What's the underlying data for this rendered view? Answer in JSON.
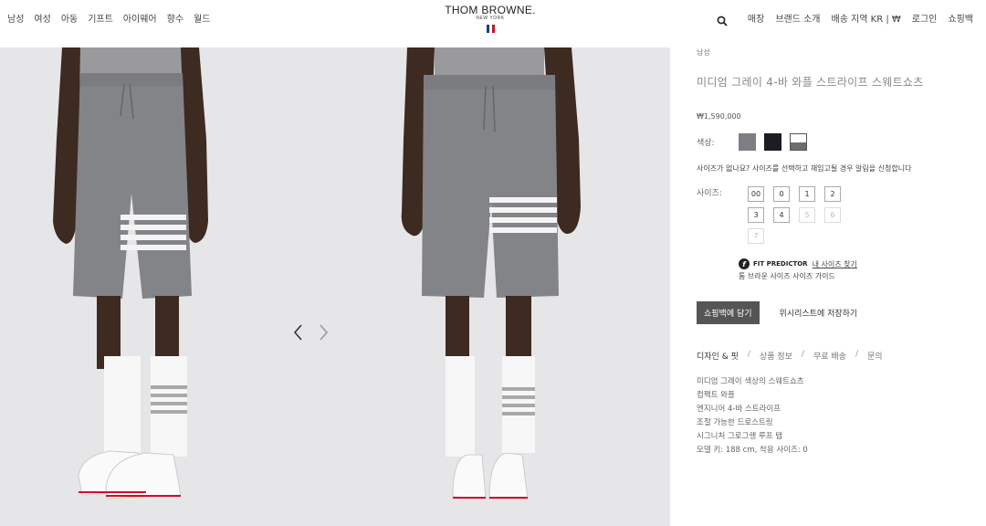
{
  "header": {
    "nav_left": [
      "남성",
      "여성",
      "아동",
      "기프트",
      "아이웨어",
      "향수",
      "월드"
    ],
    "logo_main": "THOM BROWNE.",
    "logo_sub": "NEW YORK",
    "nav_right": [
      "매장",
      "브랜드 소개",
      "배송 지역 KR | ₩",
      "로그인",
      "쇼핑백"
    ],
    "flag_colors": [
      "#1d3a8a",
      "#ffffff",
      "#c8102e"
    ]
  },
  "product": {
    "category": "남성",
    "title": "미디엄 그레이 4-바 와플 스트라이프 스웨트쇼츠",
    "price": "₩1,590,000",
    "color_label": "색상:",
    "colors": [
      {
        "name": "medium-gray",
        "hex": "#7d7f84"
      },
      {
        "name": "black",
        "hex": "#1c1d22"
      },
      {
        "name": "white-gray",
        "hex": "#ffffff"
      }
    ],
    "size_note": "사이즈가 없나요? 사이즈를 선택하고 재입고될 경우 알림을 신청합니다",
    "size_label": "사이즈:",
    "sizes": [
      {
        "label": "00",
        "available": true
      },
      {
        "label": "0",
        "available": true
      },
      {
        "label": "1",
        "available": true
      },
      {
        "label": "2",
        "available": true
      },
      {
        "label": "3",
        "available": true
      },
      {
        "label": "4",
        "available": true
      },
      {
        "label": "5",
        "available": false
      },
      {
        "label": "6",
        "available": false
      },
      {
        "label": "7",
        "available": false
      }
    ],
    "fit_predictor_label": "FIT PREDICTOR",
    "fit_link": "내 사이즈 찾기",
    "size_guide": "톰 브라운 사이즈 사이즈 가이드",
    "add_to_bag": "쇼핑백에 담기",
    "save_wishlist": "위시리스트에 저장하기",
    "tabs": [
      "디자인 & 핏",
      "상품 정보",
      "무료 배송",
      "문의"
    ],
    "description": [
      "미디엄 그레이 색상의 스웨트쇼츠",
      "컴팩트 와플",
      "엔지니어 4-바 스트라이프",
      "조절 가능한 드로스트링",
      "시그니처 그로그랭 루프 탭",
      "모델 키: 188 cm, 착용 사이즈: 0"
    ]
  },
  "gallery": {
    "prev_icon": "chevron-left-icon",
    "next_icon": "chevron-right-icon"
  }
}
